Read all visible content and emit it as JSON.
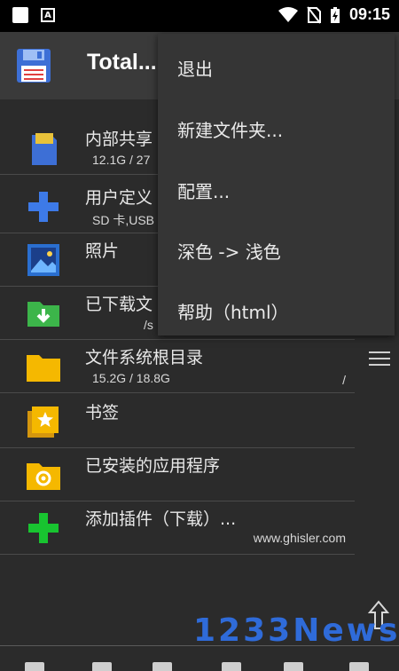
{
  "statusbar": {
    "time": "09:15",
    "notif_letter": "A"
  },
  "app": {
    "title": "Total..."
  },
  "items": [
    {
      "name": "内部共享",
      "sub": "12.1G / 27",
      "sub_right": ""
    },
    {
      "name": "用户定义",
      "sub": "SD 卡,USB",
      "sub_right": ""
    },
    {
      "name": "照片",
      "sub": "",
      "sub_right": ""
    },
    {
      "name": "已下载文",
      "sub": "",
      "sub_right": "/s"
    },
    {
      "name": "文件系统根目录",
      "sub": "15.2G / 18.8G",
      "sub_right": "/"
    },
    {
      "name": "书签",
      "sub": "",
      "sub_right": ""
    },
    {
      "name": "已安装的应用程序",
      "sub": "",
      "sub_right": ""
    },
    {
      "name": "添加插件（下载）...",
      "sub": "",
      "sub_right": "www.ghisler.com"
    }
  ],
  "menu": {
    "items": [
      "退出",
      "新建文件夹...",
      "配置...",
      "深色 -> 浅色",
      "帮助（html）"
    ]
  },
  "watermark": "1233News",
  "colors": {
    "background": "#2b2b2b",
    "toolbar": "#3a3a3a",
    "menu": "#353535",
    "watermark": "#2f6bd9"
  },
  "icons": [
    "sd-card-icon",
    "plus-icon",
    "photo-icon",
    "download-folder-icon",
    "folder-icon",
    "bookmark-icon",
    "gear-folder-icon",
    "add-plugin-icon",
    "floppy-icon",
    "hamburger-icon",
    "up-arrow-icon"
  ]
}
